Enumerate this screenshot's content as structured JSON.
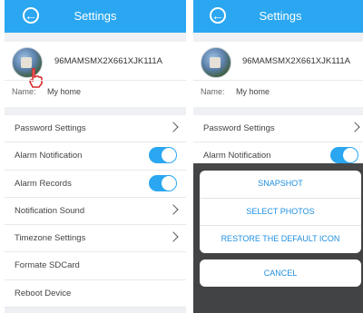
{
  "left": {
    "header": {
      "title": "Settings"
    },
    "profile": {
      "device_id": "96MAMSMX2X661XJK111A",
      "name_label": "Name:",
      "name_value": "My home"
    },
    "menu": [
      {
        "label": "Password Settings",
        "control": "chevron"
      },
      {
        "label": "Alarm Notification",
        "control": "toggle",
        "on": true
      },
      {
        "label": "Alarm Records",
        "control": "toggle",
        "on": true
      },
      {
        "label": "Notification Sound",
        "control": "chevron"
      },
      {
        "label": "Timezone Settings",
        "control": "chevron"
      },
      {
        "label": "Formate SDCard",
        "control": "none"
      },
      {
        "label": "Reboot Device",
        "control": "none"
      }
    ]
  },
  "right": {
    "header": {
      "title": "Settings"
    },
    "profile": {
      "device_id": "96MAMSMX2X661XJK111A",
      "name_label": "Name:",
      "name_value": "My home"
    },
    "menu": [
      {
        "label": "Password Settings",
        "control": "chevron"
      },
      {
        "label": "Alarm Notification",
        "control": "toggle",
        "on": true
      }
    ],
    "sheet": {
      "options": [
        "SNAPSHOT",
        "SELECT PHOTOS",
        "RESTORE THE DEFAULT ICON"
      ],
      "cancel": "CANCEL"
    }
  },
  "colors": {
    "header": "#2aa7f0",
    "accent": "#1e8fe0",
    "background": "#eef0f3"
  }
}
